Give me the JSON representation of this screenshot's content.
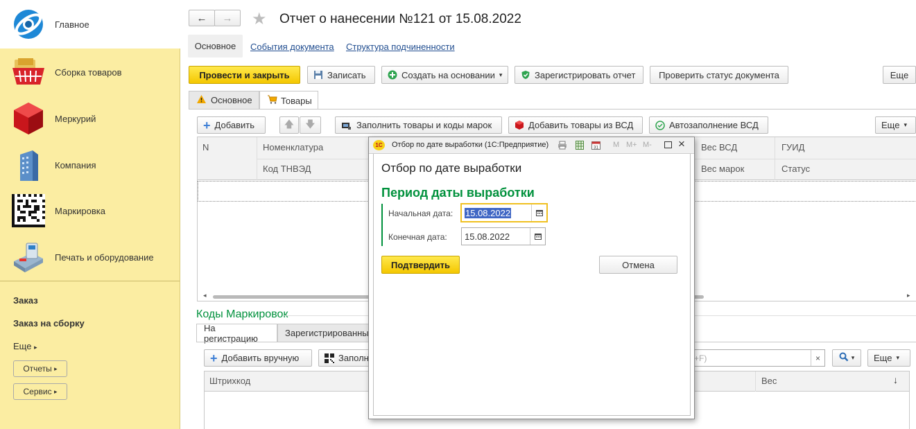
{
  "sidebar": {
    "items": [
      {
        "label": "Главное",
        "icon": "globe-logo-icon"
      },
      {
        "label": "Сборка товаров",
        "icon": "basket-icon"
      },
      {
        "label": "Меркурий",
        "icon": "red-cube-icon"
      },
      {
        "label": "Компания",
        "icon": "building-icon"
      },
      {
        "label": "Маркировка",
        "icon": "qr-code-icon"
      },
      {
        "label": "Печать и оборудование",
        "icon": "card-terminal-icon"
      }
    ],
    "links": [
      "Заказ",
      "Заказ на сборку"
    ],
    "more_label": "Еще",
    "buttons": [
      "Отчеты",
      "Сервис"
    ]
  },
  "header": {
    "title": "Отчет о нанесении №121 от 15.08.2022",
    "nav_tabs": [
      "Основное",
      "События документа",
      "Структура подчиненности"
    ]
  },
  "toolbar": {
    "post_close": "Провести и закрыть",
    "save": "Записать",
    "create_based": "Создать на основании",
    "register": "Зарегистрировать отчет",
    "check_status": "Проверить статус документа",
    "more": "Еще"
  },
  "form_tabs": [
    "Основное",
    "Товары"
  ],
  "goods_toolbar": {
    "add": "Добавить",
    "fill_goods": "Заполнить товары и коды марок",
    "add_from_vsd": "Добавить товары из ВСД",
    "autofill_vsd": "Автозаполнение ВСД",
    "more": "Еще"
  },
  "goods_table": {
    "row1": [
      "N",
      "Номенклатура",
      "Вес ВСД",
      "ГУИД"
    ],
    "row2": [
      "Код ТНВЭД",
      "Вес марок",
      "Статус"
    ]
  },
  "codes_section": {
    "title": "Коды Маркировок",
    "tabs": [
      "На регистрацию",
      "Зарегистрированные"
    ],
    "add_manual": "Добавить вручную",
    "fill": "Заполн",
    "search_hint": "+F)",
    "more": "Еще",
    "columns": [
      "Штрихкод",
      "Вес"
    ]
  },
  "dialog": {
    "window_title": "Отбор по дате выработки (1С:Предприятие)",
    "logo_text": "1С",
    "tb_m": "M",
    "tb_mplus": "M+",
    "tb_mminus": "M-",
    "heading": "Отбор по дате выработки",
    "group_title": "Период даты выработки",
    "start_label": "Начальная дата:",
    "start_value": "15.08.2022",
    "end_label": "Конечная дата:",
    "end_value": "15.08.2022",
    "confirm": "Подтвердить",
    "cancel": "Отмена"
  },
  "colors": {
    "sidebar_bg": "#fbeda2",
    "accent_green": "#00913c",
    "primary_yellow": "#f4c700",
    "link_blue": "#1f4c8f"
  }
}
